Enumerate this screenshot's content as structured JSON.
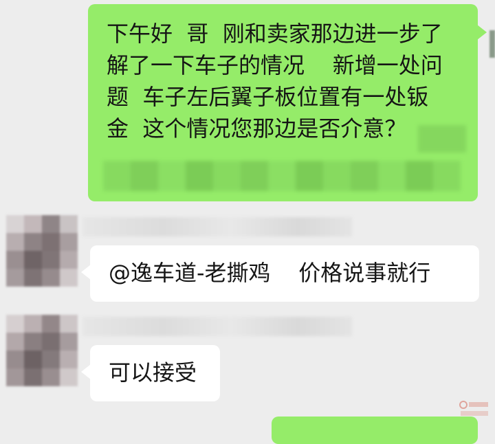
{
  "messages": [
    {
      "side": "outgoing",
      "lines": [
        "下午好  哥  刚和卖家那边进一步了",
        "解了一下车子的情况    新增一处问",
        "题  车子左后翼子板位置有一处钣",
        "金  这个情况您那边是否介意？"
      ]
    },
    {
      "side": "incoming",
      "text": "@逸车道-老撕鸡    价格说事就行"
    },
    {
      "side": "incoming",
      "text": "可以接受"
    }
  ],
  "colors": {
    "chat_background": "#ededed",
    "outgoing_bubble": "#95ec69",
    "incoming_bubble": "#ffffff",
    "text": "#151515"
  },
  "icons": {
    "avatar": "blurred-avatar",
    "watermark": "site-watermark"
  }
}
